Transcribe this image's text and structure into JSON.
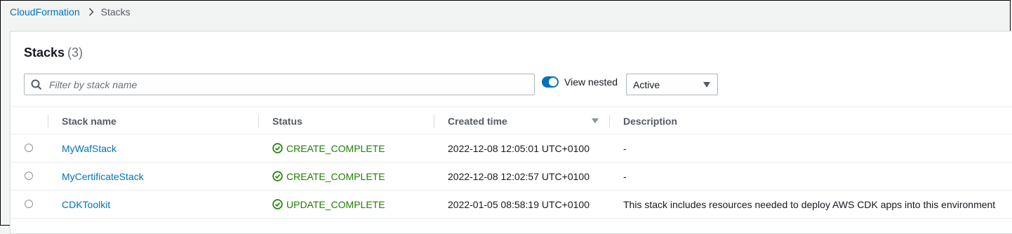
{
  "breadcrumb": {
    "root": "CloudFormation",
    "current": "Stacks"
  },
  "panel": {
    "title": "Stacks",
    "count": "(3)"
  },
  "filter": {
    "placeholder": "Filter by stack name",
    "value": ""
  },
  "view_nested": {
    "label": "View nested",
    "enabled": true
  },
  "status_select": {
    "value": "Active"
  },
  "table": {
    "columns": [
      "Stack name",
      "Status",
      "Created time",
      "Description"
    ],
    "rows": [
      {
        "name": "MyWafStack",
        "status": "CREATE_COMPLETE",
        "created": "2022-12-08 12:05:01 UTC+0100",
        "description": "-"
      },
      {
        "name": "MyCertificateStack",
        "status": "CREATE_COMPLETE",
        "created": "2022-12-08 12:02:57 UTC+0100",
        "description": "-"
      },
      {
        "name": "CDKToolkit",
        "status": "UPDATE_COMPLETE",
        "created": "2022-01-05 08:58:19 UTC+0100",
        "description": "This stack includes resources needed to deploy AWS CDK apps into this environment"
      }
    ]
  },
  "colors": {
    "link": "#0073bb",
    "success": "#1d8102",
    "toggle_on": "#0073bb"
  },
  "icons": {
    "search": "search-icon",
    "breadcrumb_separator": "chevron-right-icon",
    "status": "check-circle-icon",
    "dropdown": "caret-down-icon",
    "sort": "sort-descending-icon"
  }
}
